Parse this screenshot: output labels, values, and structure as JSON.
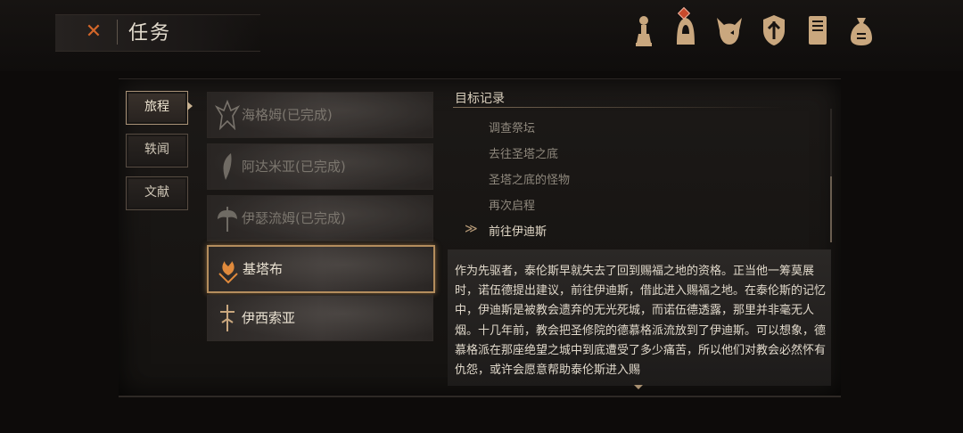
{
  "header": {
    "title": "任务",
    "close_icon": "close-x-icon",
    "nav_icons": [
      "altar-icon",
      "hooded-figure-icon",
      "demon-skull-icon",
      "shield-emblem-icon",
      "journal-book-icon",
      "coin-pouch-icon"
    ]
  },
  "sidebar": {
    "tabs": [
      {
        "label": "旅程",
        "active": true
      },
      {
        "label": "轶闻",
        "active": false
      },
      {
        "label": "文献",
        "active": false
      }
    ]
  },
  "quests": [
    {
      "label": "海格姆(已完成)",
      "status": "done",
      "icon": "winged-sigil-icon"
    },
    {
      "label": "阿达米亚(已完成)",
      "status": "done",
      "icon": "feather-blade-icon"
    },
    {
      "label": "伊瑟流姆(已完成)",
      "status": "done",
      "icon": "battle-axe-icon"
    },
    {
      "label": "基塔布",
      "status": "active",
      "icon": "flame-sigil-icon"
    },
    {
      "label": "伊西索亚",
      "status": "normal",
      "icon": "sword-crest-icon"
    }
  ],
  "objectives": {
    "title": "目标记录",
    "items": [
      {
        "label": "调查祭坛",
        "current": false
      },
      {
        "label": "去往圣塔之底",
        "current": false
      },
      {
        "label": "圣塔之底的怪物",
        "current": false
      },
      {
        "label": "再次启程",
        "current": false
      },
      {
        "label": "前往伊迪斯",
        "current": true
      }
    ],
    "current_marker": "≫"
  },
  "story": {
    "text": "作为先驱者，泰伦斯早就失去了回到赐福之地的资格。正当他一筹莫展时，诺伍德提出建议，前往伊迪斯，借此进入赐福之地。在泰伦斯的记忆中，伊迪斯是被教会遗弃的无光死城，而诺伍德透露，那里并非毫无人烟。十几年前，教会把圣修院的德慕格派流放到了伊迪斯。可以想象，德慕格派在那座绝望之城中到底遭受了多少痛苦，所以他们对教会必然怀有仇怨，或许会愿意帮助泰伦斯进入赐"
  },
  "colors": {
    "accent": "#d2662a",
    "gold_border": "#b48d5d",
    "icon_gold": "#c9a77e",
    "background": "#0d0b0a"
  }
}
